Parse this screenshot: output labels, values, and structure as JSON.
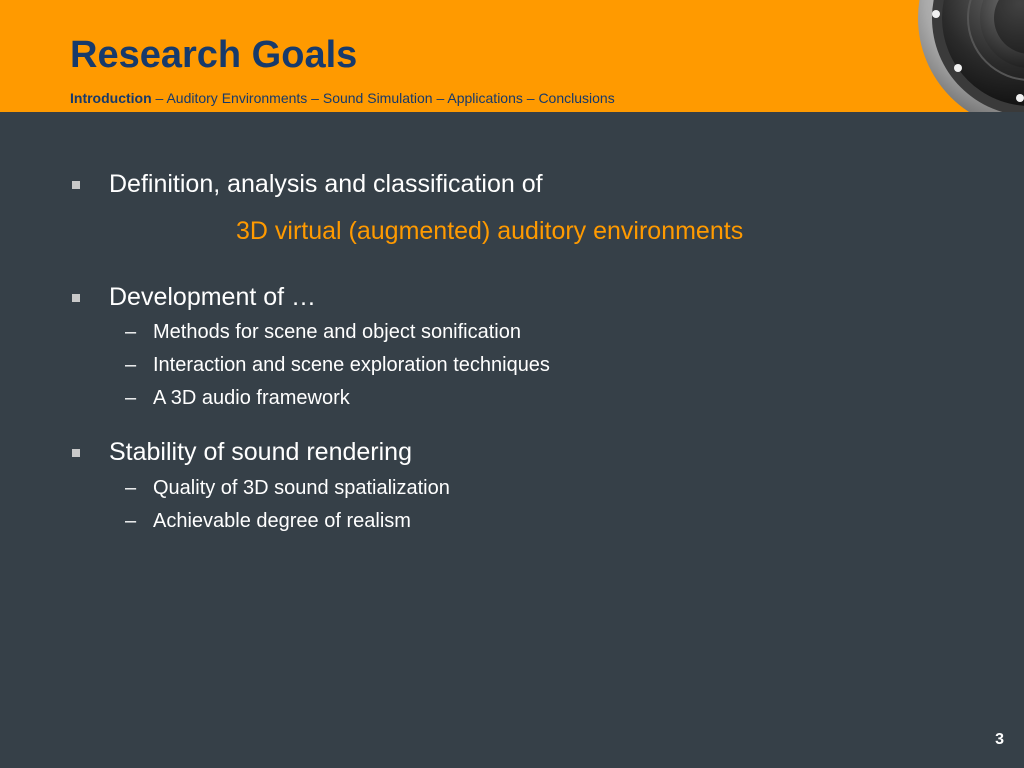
{
  "slide": {
    "title": "Research Goals",
    "breadcrumb": {
      "active": "Introduction",
      "rest": " – Auditory Environments – Sound Simulation – Applications – Conclusions"
    },
    "bullets": [
      {
        "text": "Definition, analysis and classification of",
        "highlight": "3D virtual (augmented) auditory environments"
      },
      {
        "text": "Development of …",
        "subs": [
          "Methods for scene and object sonification",
          "Interaction and scene exploration techniques",
          "A 3D audio framework"
        ]
      },
      {
        "text": "Stability of sound rendering",
        "subs": [
          "Quality of 3D sound spatialization",
          "Achievable degree of realism"
        ]
      }
    ],
    "sub_marker": "–",
    "page_number": "3"
  },
  "colors": {
    "header_bg": "#FF9A00",
    "title": "#173A6B",
    "body_bg": "#364048",
    "highlight": "#FF9A00",
    "text": "#FFFFFF"
  },
  "icons": {
    "header_graphic": "speaker-icon",
    "bullet": "square-bullet-icon"
  }
}
